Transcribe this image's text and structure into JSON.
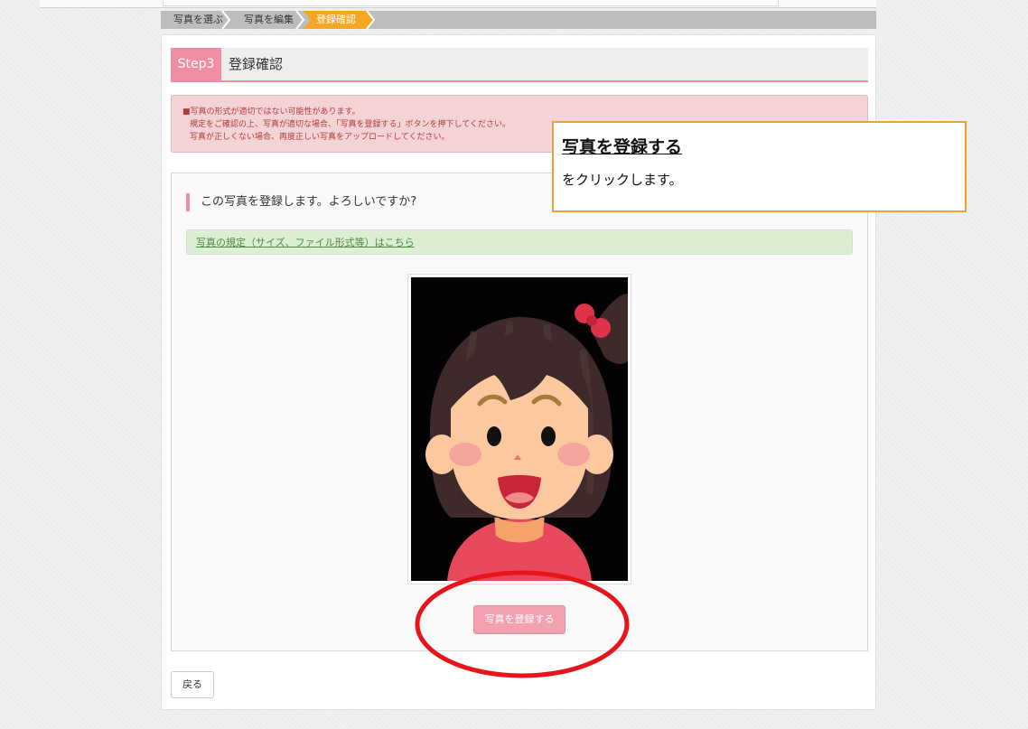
{
  "breadcrumb": {
    "steps": [
      "写真を選ぶ",
      "写真を編集",
      "登録確認"
    ],
    "active_index": 2
  },
  "step": {
    "badge": "Step3",
    "title": "登録確認"
  },
  "warning": {
    "line1": "■写真の形式が適切ではない可能性があります。",
    "line2": "規定をご確認の上、写真が適切な場合、「写真を登録する」ボタンを押下してください。",
    "line3": "写真が正しくない場合、再度正しい写真をアップロードしてください。"
  },
  "confirm": {
    "question": "この写真を登録します。よろしいですか?",
    "spec_link": "写真の規定（サイズ、ファイル形式等）はこちら",
    "register_button": "写真を登録する"
  },
  "back_button": "戻る",
  "callout": {
    "title": "写真を登録する",
    "body": "をクリックします。"
  },
  "colors": {
    "accent_pink": "#f08ea3",
    "breadcrumb_active": "#f5a623",
    "annotation_red": "#e8141b",
    "callout_border": "#f0a030"
  }
}
